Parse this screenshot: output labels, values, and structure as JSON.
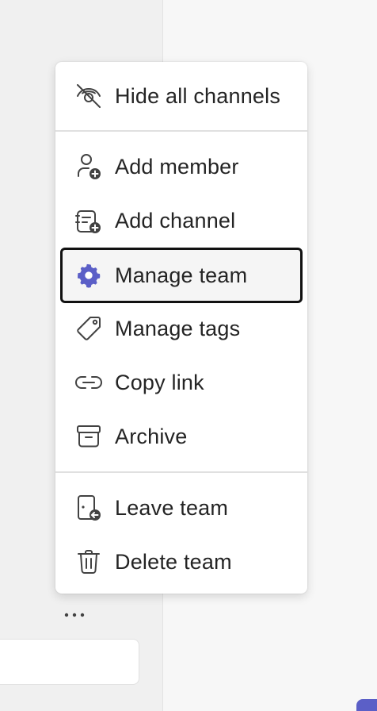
{
  "menu": {
    "items": [
      {
        "label": "Hide all channels",
        "icon": "eye-off-icon"
      },
      {
        "label": "Add member",
        "icon": "person-add-icon"
      },
      {
        "label": "Add channel",
        "icon": "channel-add-icon"
      },
      {
        "label": "Manage team",
        "icon": "gear-icon",
        "focused": true
      },
      {
        "label": "Manage tags",
        "icon": "tag-icon"
      },
      {
        "label": "Copy link",
        "icon": "link-icon"
      },
      {
        "label": "Archive",
        "icon": "archive-icon"
      },
      {
        "label": "Leave team",
        "icon": "leave-icon"
      },
      {
        "label": "Delete team",
        "icon": "trash-icon"
      }
    ]
  },
  "more_options": {
    "glyph": "•••"
  },
  "colors": {
    "accent": "#5b5fc7",
    "text": "#242424",
    "icon": "#424242",
    "divider": "#e0e0e0"
  }
}
